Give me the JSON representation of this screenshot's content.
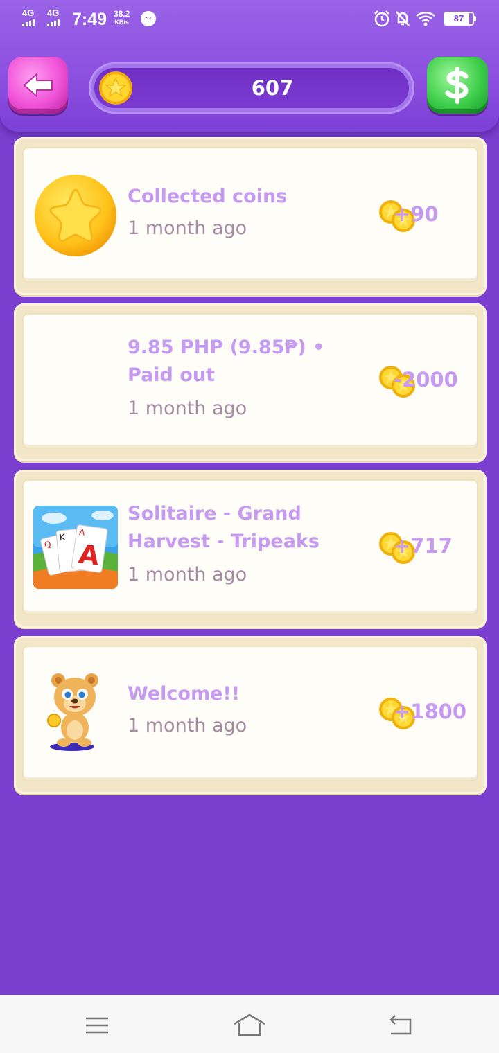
{
  "status_bar": {
    "network_1": "4G",
    "network_2": "4G",
    "time": "7:49",
    "speed": "38.2",
    "speed_unit": "KB/s",
    "battery": "87"
  },
  "header": {
    "coin_balance": "607",
    "back_icon": "back-arrow-icon",
    "cash_icon": "dollar-icon"
  },
  "transactions": [
    {
      "title": "Collected coins",
      "time": "1 month ago",
      "amount": "+90",
      "icon": "star-coin-icon"
    },
    {
      "title": "9.85 PHP (9.85₱) • Paid out",
      "time": "1 month ago",
      "amount": "-2000",
      "icon": ""
    },
    {
      "title": "Solitaire - Grand Harvest - Tripeaks",
      "time": "1 month ago",
      "amount": "+717",
      "icon": "solitaire-app-icon"
    },
    {
      "title": "Welcome!!",
      "time": "1 month ago",
      "amount": "+1800",
      "icon": "bear-mascot-icon"
    }
  ],
  "colors": {
    "background": "#7b3fd0",
    "header": "#8c4fe0",
    "card": "#fffdf8",
    "title_text": "#c69af0",
    "time_text": "#a58ba2"
  }
}
